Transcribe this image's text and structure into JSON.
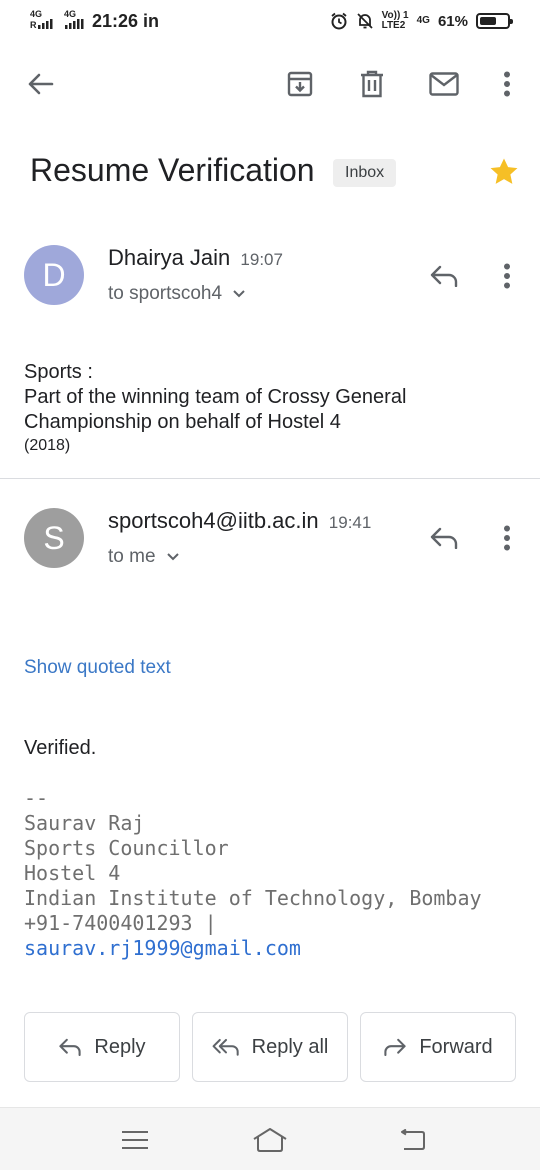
{
  "status_bar": {
    "net1": "4G",
    "net2": "4G",
    "time": "21:26 in",
    "volte": "Vo)) 1",
    "lte": "LTE2",
    "net3": "4G",
    "battery": "61%",
    "battery_level": 0.61
  },
  "email": {
    "subject": "Resume Verification",
    "label": "Inbox",
    "starred": true,
    "messages": [
      {
        "sender": "Dhairya Jain",
        "time": "19:07",
        "avatar_letter": "D",
        "avatar_color": "#9fa8da",
        "recipient": "to sportscoh4",
        "body": {
          "line1": "Sports :",
          "line2": "Part of the winning team of Crossy General",
          "line3": "Championship on behalf of Hostel 4",
          "line4": "(2018)"
        }
      },
      {
        "sender": "sportscoh4@iitb.ac.in",
        "time": "19:41",
        "avatar_letter": "S",
        "avatar_color": "#9e9e9e",
        "recipient": "to me",
        "show_quoted": "Show quoted text",
        "body_text": "Verified.",
        "signature": {
          "dash": "--",
          "name": "Saurav Raj",
          "role": "Sports Councillor",
          "hostel": "Hostel 4",
          "institute": "Indian Institute of Technology, Bombay",
          "phone": "+91-7400401293 |",
          "email": "saurav.rj1999@gmail.com"
        }
      }
    ]
  },
  "actions": {
    "reply": "Reply",
    "reply_all": "Reply all",
    "forward": "Forward"
  },
  "icons": {
    "back": "arrow-left-icon",
    "archive": "archive-icon",
    "delete": "trash-icon",
    "mark_unread": "mail-icon",
    "more": "more-vert-icon",
    "star": "star-icon",
    "reply": "reply-icon",
    "reply_all": "reply-all-icon",
    "forward": "forward-icon"
  },
  "colors": {
    "star": "#f6bf26",
    "link": "#3b78c6",
    "chip_bg": "#eeeeee"
  }
}
